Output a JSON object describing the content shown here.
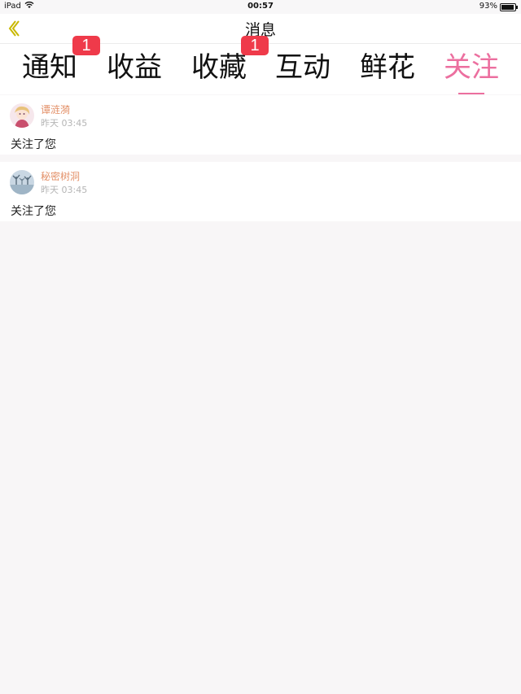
{
  "status_bar": {
    "carrier": "iPad",
    "time": "00:57",
    "battery": "93%"
  },
  "nav": {
    "title": "消息",
    "back_icon": "chevron-left-icon",
    "accent_color": "#c9b800"
  },
  "tabs": [
    {
      "label": "通知",
      "badge": "1",
      "active": false
    },
    {
      "label": "收益",
      "badge": null,
      "active": false
    },
    {
      "label": "收藏",
      "badge": "1",
      "active": false
    },
    {
      "label": "互动",
      "badge": null,
      "active": false
    },
    {
      "label": "鲜花",
      "badge": null,
      "active": false
    },
    {
      "label": "关注",
      "badge": null,
      "active": true
    }
  ],
  "colors": {
    "active_tab": "#ec6f9f",
    "badge": "#ef3a4a",
    "username": "#e39068",
    "timestamp": "#b5b5b5"
  },
  "messages": [
    {
      "username": "谭涟漪",
      "time": "昨天 03:45",
      "text": "关注了您",
      "avatar": "anime-girl-avatar"
    },
    {
      "username": "秘密树洞",
      "time": "昨天 03:45",
      "text": "关注了您",
      "avatar": "tree-avatar"
    }
  ]
}
